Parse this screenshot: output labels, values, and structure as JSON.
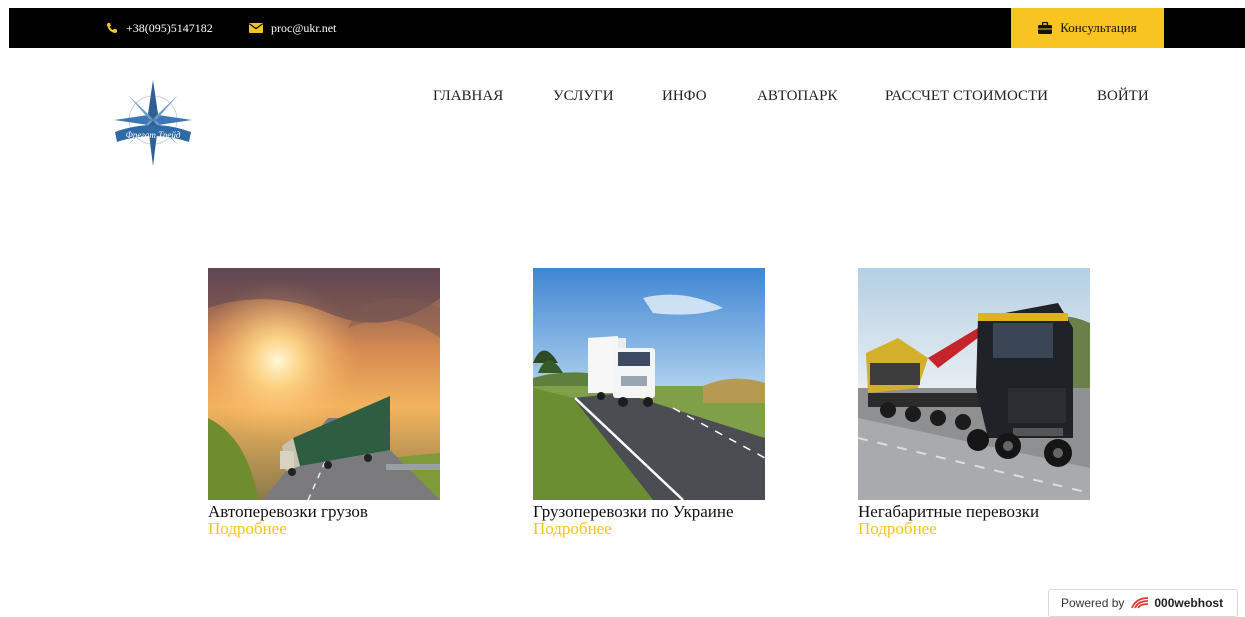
{
  "topbar": {
    "phone": "+38(095)5147182",
    "email": "proc@ukr.net",
    "consult_label": "Консультация",
    "accent_color": "#f7c422"
  },
  "logo": {
    "text": "Фрегат Трейд"
  },
  "nav": {
    "items": [
      {
        "label": "ГЛАВНАЯ"
      },
      {
        "label": "УСЛУГИ"
      },
      {
        "label": "ИНФО"
      },
      {
        "label": "АВТОПАРК"
      },
      {
        "label": "РАССЧЕТ СТОИМОСТИ"
      },
      {
        "label": "ВОЙТИ"
      }
    ]
  },
  "services": [
    {
      "title": "Автоперевозки грузов",
      "more": "Подробнее"
    },
    {
      "title": "Грузоперевозки по Украине",
      "more": "Подробнее"
    },
    {
      "title": "Негабаритные перевозки",
      "more": "Подробнее"
    }
  ],
  "footer": {
    "powered_by": "Powered by",
    "brand": "000webhost"
  }
}
